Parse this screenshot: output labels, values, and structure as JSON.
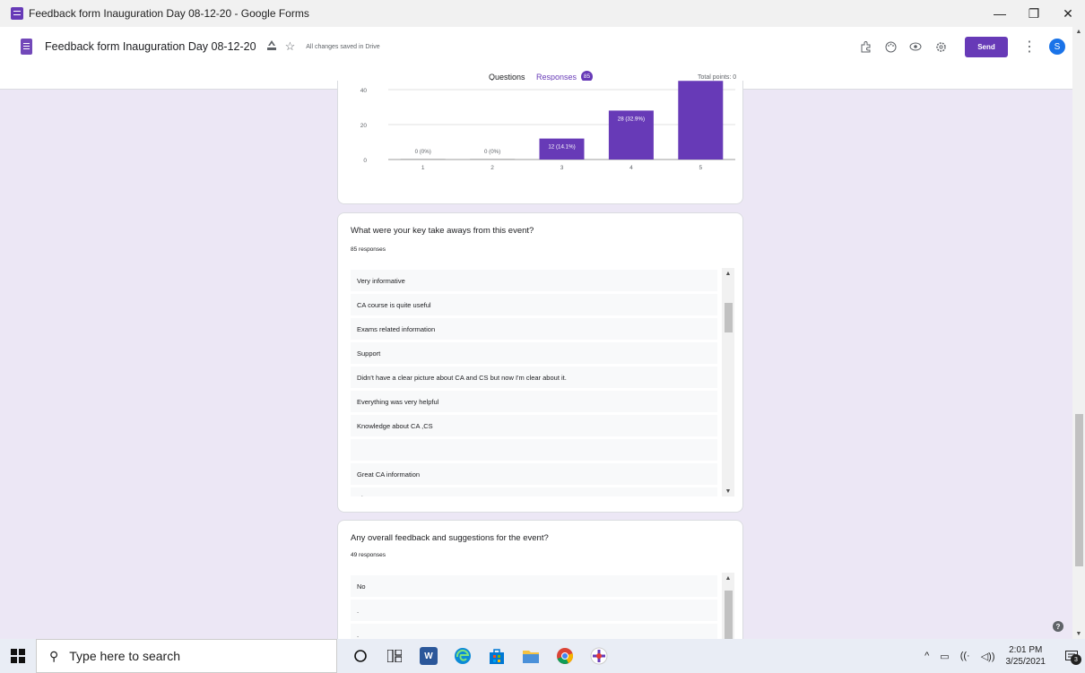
{
  "window": {
    "title": "Feedback form Inauguration Day 08-12-20 - Google Forms",
    "minimize": "—",
    "maximize": "❐",
    "close": "✕"
  },
  "header": {
    "form_title": "Feedback form Inauguration Day 08-12-20",
    "saved_status": "All changes saved in Drive",
    "send_label": "Send",
    "avatar_letter": "S"
  },
  "tabs": {
    "questions": "Questions",
    "responses": "Responses",
    "response_count": "85",
    "total_points": "Total points: 0"
  },
  "chart_data": {
    "type": "bar",
    "categories": [
      "1",
      "2",
      "3",
      "4",
      "5"
    ],
    "values": [
      0,
      0,
      12,
      28,
      45
    ],
    "data_labels": [
      "0 (0%)",
      "0 (0%)",
      "12 (14.1%)",
      "28 (32.9%)",
      ""
    ],
    "y_ticks": [
      "0",
      "20",
      "40"
    ],
    "ylim": [
      0,
      40
    ],
    "bar_color": "#673ab7"
  },
  "questions": [
    {
      "title": "What were your key take aways from this event?",
      "count": "85 responses",
      "responses": [
        "Very informative",
        "CA course is quite useful",
        "Exams related information",
        "Support",
        "Didn't have a clear picture about CA and CS but now I'm clear about it.",
        "Everything was very helpful",
        "Knowledge about CA ,CS",
        "",
        "Great CA information",
        "About CA Exams"
      ]
    },
    {
      "title": "Any overall feedback and suggestions for the event?",
      "count": "49 responses",
      "responses": [
        "No",
        ".",
        "."
      ]
    }
  ],
  "taskbar": {
    "search_placeholder": "Type here to search",
    "time": "2:01 PM",
    "date": "3/25/2021",
    "notification_count": "3"
  },
  "colors": {
    "accent": "#673ab7",
    "page_bg": "#ece7f5"
  }
}
